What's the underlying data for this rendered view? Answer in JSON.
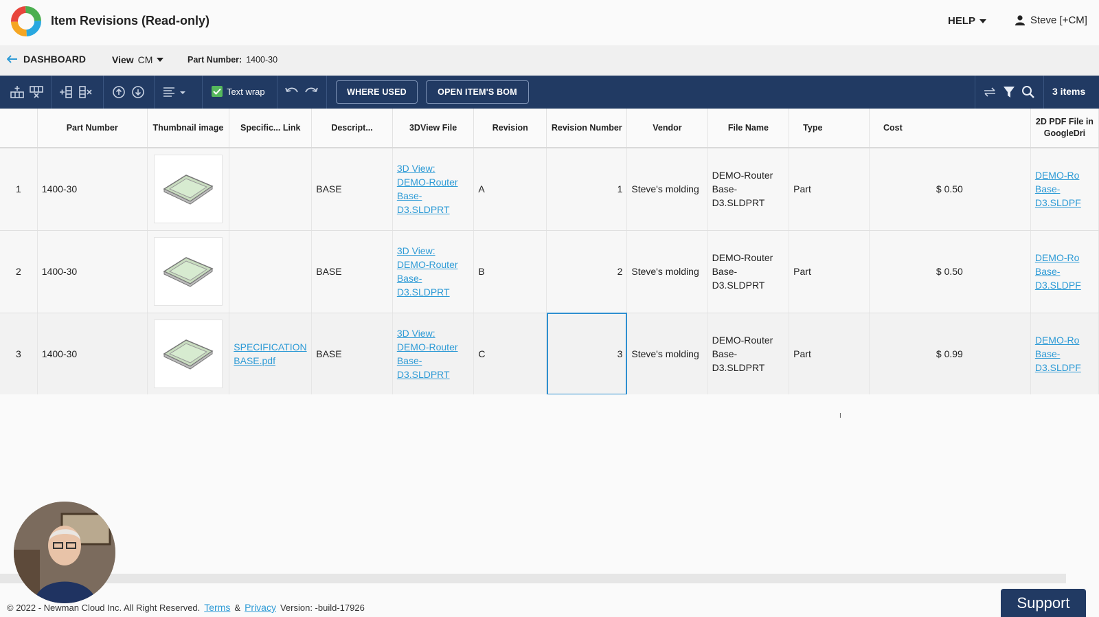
{
  "header": {
    "title": "Item Revisions (Read-only)",
    "help_label": "HELP",
    "user_label": "Steve [+CM]"
  },
  "subbar": {
    "back_label": "DASHBOARD",
    "view_label": "View",
    "view_value": "CM",
    "part_number_label": "Part Number:",
    "part_number_value": "1400-30"
  },
  "toolbar": {
    "text_wrap_label": "Text wrap",
    "where_used_label": "WHERE USED",
    "open_bom_label": "OPEN ITEM'S BOM",
    "items_count": "3 items",
    "accent": "#213a63"
  },
  "table": {
    "columns": [
      "",
      "Part Number",
      "Thumbnail image",
      "Specific... Link",
      "Descript...",
      "3DView File",
      "Revision",
      "Revision Number",
      "Vendor",
      "File Name",
      "Type",
      "Cost",
      "2D PDF File in GoogleDri"
    ],
    "rows": [
      {
        "index": "1",
        "part_number": "1400-30",
        "spec_link": "",
        "description": "BASE",
        "view3d": "3D View: DEMO-Router Base-D3.SLDPRT",
        "revision": "A",
        "revision_number": "1",
        "vendor": "Steve's molding",
        "file_name": "DEMO-Router Base-D3.SLDPRT",
        "type": "Part",
        "cost": "$ 0.50",
        "pdf": "DEMO-Ro Base-D3.SLDPF"
      },
      {
        "index": "2",
        "part_number": "1400-30",
        "spec_link": "",
        "description": "BASE",
        "view3d": "3D View: DEMO-Router Base-D3.SLDPRT",
        "revision": "B",
        "revision_number": "2",
        "vendor": "Steve's molding",
        "file_name": "DEMO-Router Base-D3.SLDPRT",
        "type": "Part",
        "cost": "$ 0.50",
        "pdf": "DEMO-Ro Base-D3.SLDPF"
      },
      {
        "index": "3",
        "part_number": "1400-30",
        "spec_link": "SPECIFICATION BASE.pdf",
        "description": "BASE",
        "view3d": "3D View: DEMO-Router Base-D3.SLDPRT",
        "revision": "C",
        "revision_number": "3",
        "vendor": "Steve's molding",
        "file_name": "DEMO-Router Base-D3.SLDPRT",
        "type": "Part",
        "cost": "$ 0.99",
        "pdf": "DEMO-Ro Base-D3.SLDPF"
      }
    ]
  },
  "footer": {
    "copyright": "© 2022 - Newman Cloud Inc. All Right Reserved.",
    "terms": "Terms",
    "amp": "&",
    "privacy": "Privacy",
    "version": "Version: -build-17926"
  },
  "support_label": "Support"
}
